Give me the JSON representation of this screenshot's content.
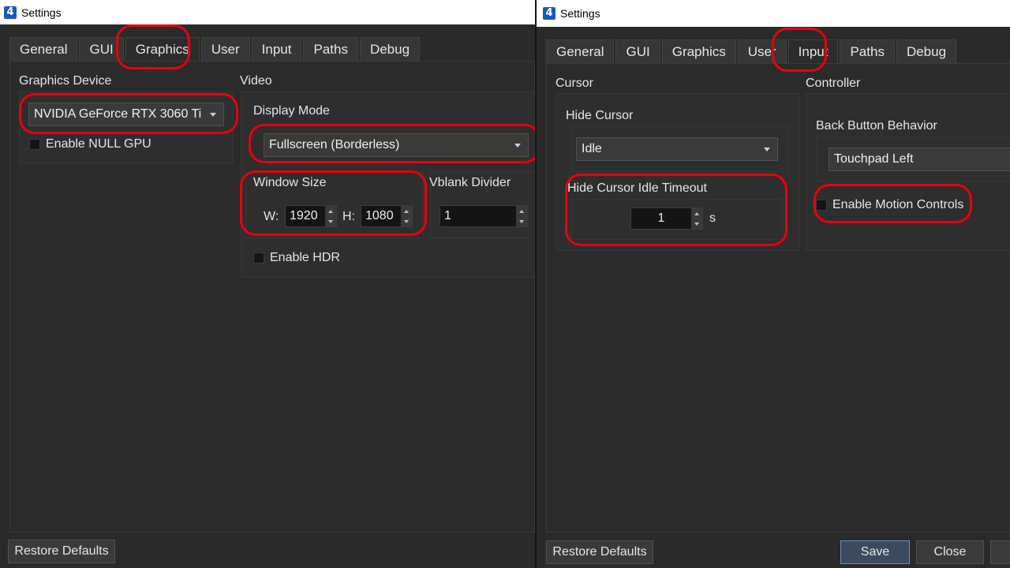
{
  "left_window": {
    "title": "Settings",
    "icon_text": "4",
    "tabs": [
      "General",
      "GUI",
      "Graphics",
      "User",
      "Input",
      "Paths",
      "Debug"
    ],
    "active_tab": "Graphics",
    "graphics_device": {
      "title": "Graphics Device",
      "selected": "NVIDIA GeForce RTX 3060 Ti",
      "null_gpu_label": "Enable NULL GPU"
    },
    "video": {
      "title": "Video",
      "display_mode_title": "Display Mode",
      "display_mode_selected": "Fullscreen (Borderless)",
      "window_size_title": "Window Size",
      "width_label": "W:",
      "width_value": "1920",
      "height_label": "H:",
      "height_value": "1080",
      "vblank_title": "Vblank Divider",
      "vblank_value": "1",
      "hdr_label": "Enable HDR"
    },
    "restore_defaults_label": "Restore Defaults"
  },
  "right_window": {
    "title": "Settings",
    "icon_text": "4",
    "tabs": [
      "General",
      "GUI",
      "Graphics",
      "User",
      "Input",
      "Paths",
      "Debug"
    ],
    "active_tab": "Input",
    "cursor": {
      "title": "Cursor",
      "hide_cursor_title": "Hide Cursor",
      "hide_cursor_selected": "Idle",
      "idle_timeout_title": "Hide Cursor Idle Timeout",
      "idle_timeout_value": "1",
      "idle_timeout_unit": "s"
    },
    "controller": {
      "title": "Controller",
      "back_button_title": "Back Button Behavior",
      "back_button_selected": "Touchpad Left",
      "motion_controls_label": "Enable Motion Controls"
    },
    "restore_defaults_label": "Restore Defaults",
    "save_label": "Save",
    "close_label": "Close"
  },
  "colors": {
    "highlight_ring": "#e8000e",
    "window_bg": "#2a2a2a",
    "titlebar_bg": "#ffffff",
    "app_icon": "#1c58c5"
  }
}
